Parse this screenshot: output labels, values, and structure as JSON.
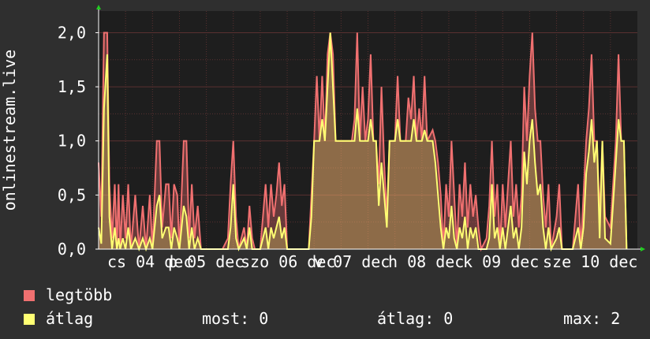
{
  "chart_data": {
    "type": "area",
    "ylabel": "onlinestream.live",
    "ylim": [
      0,
      2.2
    ],
    "yticks": [
      "0,0",
      "0,5",
      "1,0",
      "1,5",
      "2,0"
    ],
    "ytick_values": [
      0,
      0.5,
      1.0,
      1.5,
      2.0
    ],
    "xticks": [
      "cs 04 dec",
      "p 05 dec",
      "szo 06 dec",
      "v 07 dec",
      "h 08 dec",
      "k 09 dec",
      "sze 10 dec"
    ],
    "grid": true,
    "legend_placement": "bottom-left",
    "colors": {
      "max_series": "#f07070",
      "avg_series": "#ffff73",
      "plot_bg": "#1e1e1e",
      "grid": "#5a3030"
    },
    "x_range": [
      0,
      100
    ],
    "series": [
      {
        "name": "legtöbb",
        "color": "#f07070",
        "points": [
          [
            0,
            0.8
          ],
          [
            0.5,
            0.3
          ],
          [
            1,
            2.0
          ],
          [
            1.6,
            2.0
          ],
          [
            2,
            0.6
          ],
          [
            2.5,
            0.1
          ],
          [
            3,
            0.6
          ],
          [
            3.4,
            0
          ],
          [
            3.7,
            0.6
          ],
          [
            4,
            0
          ],
          [
            4.5,
            0.5
          ],
          [
            5,
            0.1
          ],
          [
            5.5,
            0.6
          ],
          [
            6,
            0
          ],
          [
            6.8,
            0.5
          ],
          [
            7.5,
            0
          ],
          [
            8.2,
            0.4
          ],
          [
            8.8,
            0
          ],
          [
            9.5,
            0.5
          ],
          [
            10,
            0
          ],
          [
            10.8,
            1.0
          ],
          [
            11.3,
            1.0
          ],
          [
            11.8,
            0.2
          ],
          [
            12.5,
            0.6
          ],
          [
            13,
            0.6
          ],
          [
            13.5,
            0.1
          ],
          [
            14,
            0.6
          ],
          [
            14.6,
            0.5
          ],
          [
            15,
            0
          ],
          [
            15.8,
            1.0
          ],
          [
            16.3,
            1.0
          ],
          [
            16.8,
            0.1
          ],
          [
            17.3,
            0.6
          ],
          [
            17.8,
            0.1
          ],
          [
            18.4,
            0.4
          ],
          [
            19,
            0
          ],
          [
            21,
            0
          ],
          [
            23,
            0
          ],
          [
            24,
            0.1
          ],
          [
            24.5,
            0.6
          ],
          [
            25,
            1.0
          ],
          [
            25.5,
            0.3
          ],
          [
            26,
            0
          ],
          [
            27,
            0.2
          ],
          [
            27.5,
            0
          ],
          [
            28,
            0.4
          ],
          [
            28.5,
            0.1
          ],
          [
            29,
            0
          ],
          [
            30,
            0
          ],
          [
            31,
            0.6
          ],
          [
            31.5,
            0.2
          ],
          [
            32,
            0.6
          ],
          [
            32.5,
            0.3
          ],
          [
            33,
            0.5
          ],
          [
            33.5,
            0.8
          ],
          [
            34,
            0.4
          ],
          [
            34.5,
            0.6
          ],
          [
            35,
            0
          ],
          [
            37,
            0
          ],
          [
            39,
            0
          ],
          [
            39.5,
            0.5
          ],
          [
            40,
            1.0
          ],
          [
            40.5,
            1.6
          ],
          [
            41,
            1.0
          ],
          [
            41.5,
            1.6
          ],
          [
            42,
            1.0
          ],
          [
            42.5,
            1.8
          ],
          [
            43,
            2.0
          ],
          [
            43.5,
            1.8
          ],
          [
            44,
            1.0
          ],
          [
            45,
            1.0
          ],
          [
            46,
            1.0
          ],
          [
            47,
            1.0
          ],
          [
            47.5,
            1.2
          ],
          [
            48,
            2.0
          ],
          [
            48.5,
            1.0
          ],
          [
            49,
            1.5
          ],
          [
            49.5,
            1.0
          ],
          [
            50,
            1.2
          ],
          [
            50.5,
            1.8
          ],
          [
            51,
            1.0
          ],
          [
            51.5,
            1.0
          ],
          [
            52,
            0.6
          ],
          [
            52.5,
            1.5
          ],
          [
            53,
            0.8
          ],
          [
            53.5,
            0.3
          ],
          [
            54,
            1.0
          ],
          [
            55,
            1.0
          ],
          [
            55.5,
            1.6
          ],
          [
            56,
            1.0
          ],
          [
            57,
            1.0
          ],
          [
            57.5,
            1.4
          ],
          [
            58,
            1.2
          ],
          [
            58.5,
            1.6
          ],
          [
            59,
            1.0
          ],
          [
            59.5,
            1.3
          ],
          [
            60,
            1.0
          ],
          [
            60.5,
            1.6
          ],
          [
            61,
            1.0
          ],
          [
            62,
            1.1
          ],
          [
            62.5,
            1.0
          ],
          [
            63,
            0.8
          ],
          [
            63.5,
            0.5
          ],
          [
            64,
            0
          ],
          [
            64.5,
            0.6
          ],
          [
            65,
            0.3
          ],
          [
            65.5,
            1.0
          ],
          [
            66,
            0.5
          ],
          [
            66.5,
            0
          ],
          [
            67,
            0.6
          ],
          [
            67.5,
            0.3
          ],
          [
            68,
            0.8
          ],
          [
            68.5,
            0.2
          ],
          [
            69,
            0.6
          ],
          [
            69.5,
            0.3
          ],
          [
            70,
            0.5
          ],
          [
            70.5,
            0.2
          ],
          [
            71,
            0
          ],
          [
            72,
            0.1
          ],
          [
            72.5,
            0.4
          ],
          [
            73,
            1.0
          ],
          [
            73.5,
            0.3
          ],
          [
            74,
            0.6
          ],
          [
            74.5,
            0
          ],
          [
            75,
            0.6
          ],
          [
            75.5,
            0.2
          ],
          [
            76,
            0.6
          ],
          [
            76.5,
            1.0
          ],
          [
            77,
            0.3
          ],
          [
            77.5,
            0.6
          ],
          [
            78,
            0.2
          ],
          [
            78.5,
            0.5
          ],
          [
            79,
            1.5
          ],
          [
            79.5,
            1.0
          ],
          [
            80,
            1.6
          ],
          [
            80.5,
            2.0
          ],
          [
            81,
            1.3
          ],
          [
            81.5,
            1.0
          ],
          [
            82,
            1.0
          ],
          [
            82.5,
            0.5
          ],
          [
            83,
            0.2
          ],
          [
            83.5,
            0.6
          ],
          [
            84,
            0
          ],
          [
            85,
            0.3
          ],
          [
            85.5,
            0.6
          ],
          [
            86,
            0
          ],
          [
            88,
            0
          ],
          [
            89,
            0.6
          ],
          [
            89.5,
            0
          ],
          [
            90,
            0.5
          ],
          [
            90.5,
            1.0
          ],
          [
            91,
            1.3
          ],
          [
            91.5,
            1.8
          ],
          [
            92,
            1.0
          ],
          [
            92.5,
            1.0
          ],
          [
            93,
            0.3
          ],
          [
            93.5,
            1.0
          ],
          [
            94,
            0.3
          ],
          [
            95,
            0.2
          ],
          [
            96,
            1.0
          ],
          [
            96.5,
            1.8
          ],
          [
            97,
            1.0
          ],
          [
            97.5,
            1.0
          ],
          [
            98,
            0
          ]
        ]
      },
      {
        "name": "átlag",
        "color": "#ffff73",
        "points": [
          [
            0,
            0.2
          ],
          [
            0.5,
            0.05
          ],
          [
            1,
            1.3
          ],
          [
            1.6,
            1.8
          ],
          [
            2,
            0.3
          ],
          [
            2.5,
            0
          ],
          [
            3,
            0.2
          ],
          [
            3.4,
            0
          ],
          [
            3.7,
            0.1
          ],
          [
            4,
            0
          ],
          [
            4.5,
            0.1
          ],
          [
            5,
            0
          ],
          [
            5.5,
            0.2
          ],
          [
            6,
            0
          ],
          [
            6.8,
            0.1
          ],
          [
            7.5,
            0
          ],
          [
            8.2,
            0.1
          ],
          [
            8.8,
            0
          ],
          [
            9.5,
            0.1
          ],
          [
            10,
            0
          ],
          [
            10.8,
            0.4
          ],
          [
            11.3,
            0.5
          ],
          [
            11.8,
            0.1
          ],
          [
            12.5,
            0.2
          ],
          [
            13,
            0.2
          ],
          [
            13.5,
            0
          ],
          [
            14,
            0.2
          ],
          [
            14.6,
            0.1
          ],
          [
            15,
            0
          ],
          [
            15.8,
            0.4
          ],
          [
            16.3,
            0.3
          ],
          [
            16.8,
            0
          ],
          [
            17.3,
            0.2
          ],
          [
            17.8,
            0
          ],
          [
            18.4,
            0.1
          ],
          [
            19,
            0
          ],
          [
            21,
            0
          ],
          [
            23,
            0
          ],
          [
            24,
            0
          ],
          [
            24.5,
            0.2
          ],
          [
            25,
            0.6
          ],
          [
            25.5,
            0.1
          ],
          [
            26,
            0
          ],
          [
            27,
            0.1
          ],
          [
            27.5,
            0
          ],
          [
            28,
            0.2
          ],
          [
            28.5,
            0
          ],
          [
            29,
            0
          ],
          [
            30,
            0
          ],
          [
            31,
            0.2
          ],
          [
            31.5,
            0
          ],
          [
            32,
            0.2
          ],
          [
            32.5,
            0.1
          ],
          [
            33,
            0.2
          ],
          [
            33.5,
            0.3
          ],
          [
            34,
            0.1
          ],
          [
            34.5,
            0.2
          ],
          [
            35,
            0
          ],
          [
            37,
            0
          ],
          [
            39,
            0
          ],
          [
            39.5,
            0.3
          ],
          [
            40,
            1.0
          ],
          [
            40.5,
            1.0
          ],
          [
            41,
            1.0
          ],
          [
            41.5,
            1.2
          ],
          [
            42,
            1.0
          ],
          [
            42.5,
            1.5
          ],
          [
            43,
            2.0
          ],
          [
            43.5,
            1.5
          ],
          [
            44,
            1.0
          ],
          [
            45,
            1.0
          ],
          [
            46,
            1.0
          ],
          [
            47,
            1.0
          ],
          [
            47.5,
            1.0
          ],
          [
            48,
            1.3
          ],
          [
            48.5,
            1.0
          ],
          [
            49,
            1.0
          ],
          [
            49.5,
            1.0
          ],
          [
            50,
            1.0
          ],
          [
            50.5,
            1.2
          ],
          [
            51,
            1.0
          ],
          [
            51.5,
            1.0
          ],
          [
            52,
            0.4
          ],
          [
            52.5,
            0.8
          ],
          [
            53,
            0.5
          ],
          [
            53.5,
            0.2
          ],
          [
            54,
            1.0
          ],
          [
            55,
            1.0
          ],
          [
            55.5,
            1.2
          ],
          [
            56,
            1.0
          ],
          [
            57,
            1.0
          ],
          [
            57.5,
            1.0
          ],
          [
            58,
            1.0
          ],
          [
            58.5,
            1.2
          ],
          [
            59,
            1.0
          ],
          [
            59.5,
            1.0
          ],
          [
            60,
            1.0
          ],
          [
            60.5,
            1.1
          ],
          [
            61,
            1.0
          ],
          [
            62,
            1.0
          ],
          [
            62.5,
            0.8
          ],
          [
            63,
            0.5
          ],
          [
            63.5,
            0.2
          ],
          [
            64,
            0
          ],
          [
            64.5,
            0.2
          ],
          [
            65,
            0.1
          ],
          [
            65.5,
            0.4
          ],
          [
            66,
            0.1
          ],
          [
            66.5,
            0
          ],
          [
            67,
            0.2
          ],
          [
            67.5,
            0.1
          ],
          [
            68,
            0.3
          ],
          [
            68.5,
            0
          ],
          [
            69,
            0.2
          ],
          [
            69.5,
            0.1
          ],
          [
            70,
            0.2
          ],
          [
            70.5,
            0
          ],
          [
            71,
            0
          ],
          [
            72,
            0
          ],
          [
            72.5,
            0.1
          ],
          [
            73,
            0.6
          ],
          [
            73.5,
            0.1
          ],
          [
            74,
            0.2
          ],
          [
            74.5,
            0
          ],
          [
            75,
            0.2
          ],
          [
            75.5,
            0
          ],
          [
            76,
            0.2
          ],
          [
            76.5,
            0.4
          ],
          [
            77,
            0.1
          ],
          [
            77.5,
            0.2
          ],
          [
            78,
            0
          ],
          [
            78.5,
            0.2
          ],
          [
            79,
            0.9
          ],
          [
            79.5,
            0.6
          ],
          [
            80,
            1.0
          ],
          [
            80.5,
            1.2
          ],
          [
            81,
            0.8
          ],
          [
            81.5,
            0.5
          ],
          [
            82,
            0.6
          ],
          [
            82.5,
            0.2
          ],
          [
            83,
            0
          ],
          [
            83.5,
            0.2
          ],
          [
            84,
            0
          ],
          [
            85,
            0.1
          ],
          [
            85.5,
            0.2
          ],
          [
            86,
            0
          ],
          [
            88,
            0
          ],
          [
            89,
            0.2
          ],
          [
            89.5,
            0
          ],
          [
            90,
            0.2
          ],
          [
            90.5,
            0.7
          ],
          [
            91,
            0.9
          ],
          [
            91.5,
            1.2
          ],
          [
            92,
            0.8
          ],
          [
            92.5,
            1.0
          ],
          [
            93,
            0.1
          ],
          [
            93.5,
            1.0
          ],
          [
            94,
            0.1
          ],
          [
            95,
            0.05
          ],
          [
            96,
            0.8
          ],
          [
            96.5,
            1.2
          ],
          [
            97,
            1.0
          ],
          [
            97.5,
            1.0
          ],
          [
            98,
            0
          ]
        ]
      }
    ]
  },
  "legend": [
    {
      "label": "legtöbb",
      "color": "#f07070"
    },
    {
      "label": "átlag",
      "color": "#ffff73"
    }
  ],
  "stats": {
    "now": "most: 0",
    "avg": "átlag: 0",
    "max": "max: 2"
  }
}
